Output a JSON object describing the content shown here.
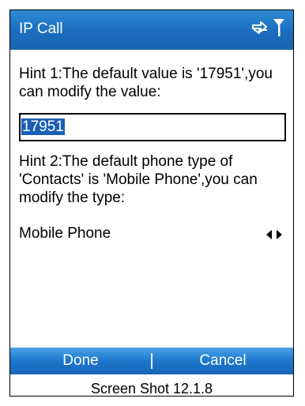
{
  "window": {
    "title": "IP Call",
    "status_icons": [
      "data-connection-icon",
      "signal-strength-icon"
    ]
  },
  "form": {
    "hint1": "Hint 1:The default value is '17951',you can modify the value:",
    "ip_prefix_value": "17951",
    "hint2": "Hint 2:The default phone type of 'Contacts' is 'Mobile Phone',you can modify the type:",
    "phone_type_value": "Mobile Phone"
  },
  "softkeys": {
    "left_label": "Done",
    "right_label": "Cancel"
  },
  "caption": "Screen Shot 12.1.8",
  "colors": {
    "titlebar": "#1b6dbd",
    "softkey_bar": "#1d77cc",
    "selection": "#1a5fb5"
  }
}
